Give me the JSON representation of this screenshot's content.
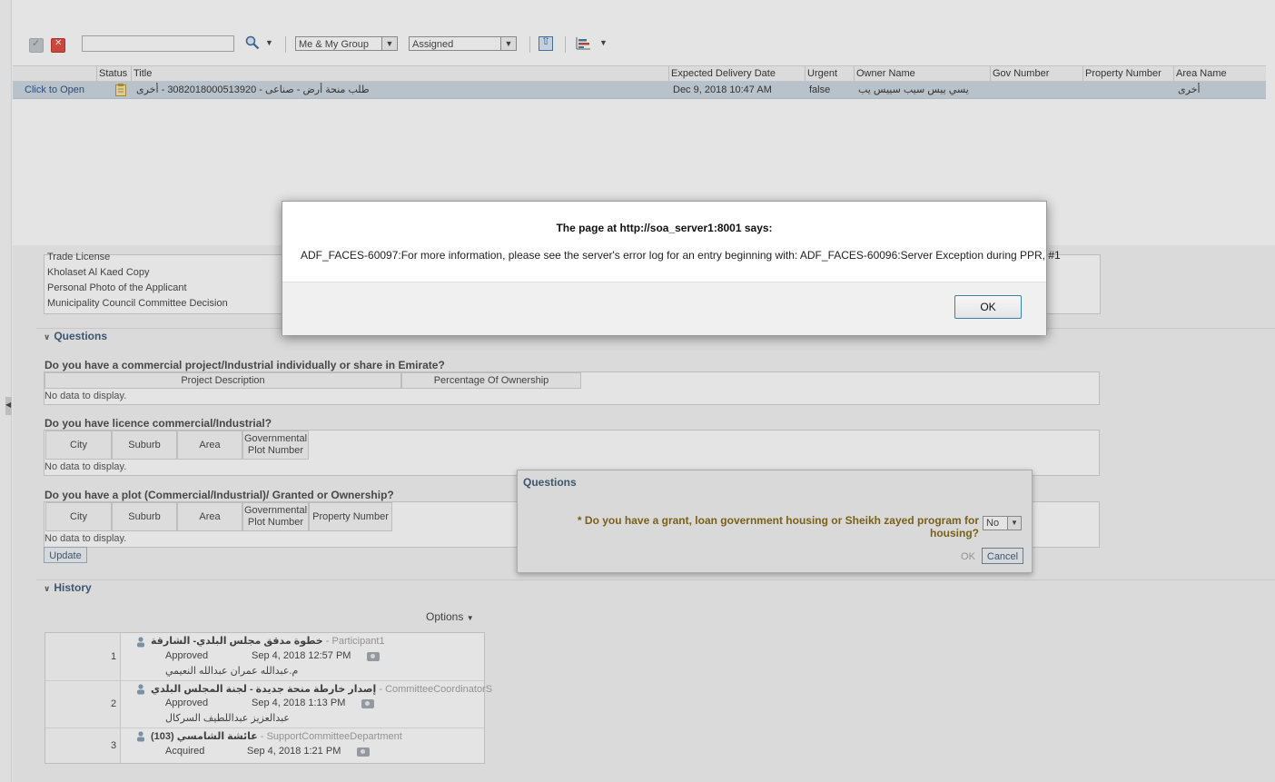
{
  "toolbar": {
    "search_value": "",
    "filter_select": "Me & My Group",
    "state_select": "Assigned"
  },
  "task_table": {
    "columns": [
      "Status",
      "Title",
      "Expected Delivery Date",
      "Urgent",
      "Owner Name",
      "Gov Number",
      "Property Number",
      "Area Name"
    ],
    "row": {
      "open_link": "Click to Open",
      "title": "طلب منحة أرض - صناعى - 3082018000513920 - أخرى",
      "expected_delivery": "Dec 9, 2018 10:47 AM",
      "urgent": "false",
      "owner": "يسي ييس سيب سييس يب",
      "gov_number": "",
      "property_number": "",
      "area": "أخرى"
    }
  },
  "documents": [
    "Trade License",
    "Kholaset Al Kaed Copy",
    "Personal Photo of the Applicant",
    "Municipality Council Committee Decision"
  ],
  "questions": {
    "header": "Questions",
    "q1": {
      "label": "Do you have a commercial project/Industrial individually or share in Emirate?",
      "columns": [
        "Project Description",
        "Percentage Of Ownership"
      ],
      "empty": "No data to display."
    },
    "q2": {
      "label": "Do you have licence commercial/Industrial?",
      "columns": [
        "City",
        "Suburb",
        "Area",
        "Governmental Plot Number"
      ],
      "empty": "No data to display."
    },
    "q3": {
      "label": "Do you have a plot (Commercial/Industrial)/ Granted or Ownership?",
      "columns": [
        "City",
        "Suburb",
        "Area",
        "Governmental Plot Number",
        "Property Number"
      ],
      "empty": "No data to display."
    },
    "update_label": "Update"
  },
  "history": {
    "header": "History",
    "options_label": "Options",
    "rows": [
      {
        "num": "1",
        "step": "خطوة مدقق مجلس البلدي- الشارقة",
        "role": "- Participant1",
        "status": "Approved",
        "date": "Sep 4, 2018 12:57 PM",
        "user": "م.عبدالله عمران عبدالله النعيمي"
      },
      {
        "num": "2",
        "step": "إصدار خارطة منحة جديدة - لجنة المجلس البلدي",
        "role": "- CommitteeCoordinatorS",
        "status": "Approved",
        "date": "Sep 4, 2018 1:13 PM",
        "user": "عبدالعزيز عبداللطيف السركال"
      },
      {
        "num": "3",
        "step": "عائشة الشامسي (103)",
        "role": "- SupportCommitteeDepartment",
        "status": "Acquired",
        "date": "Sep 4, 2018 1:21 PM",
        "user": ""
      }
    ]
  },
  "q_popup": {
    "title": "Questions",
    "required_mark": "*",
    "question": "Do you have a grant, loan government housing or Sheikh zayed program for housing?",
    "answer": "No",
    "ok_label": "OK",
    "cancel_label": "Cancel"
  },
  "alert": {
    "title": "The page at http://soa_server1:8001 says:",
    "message": "ADF_FACES-60097:For more information, please see the server's error log for an entry beginning with: ADF_FACES-60096:Server Exception during PPR, #1",
    "ok_label": "OK"
  }
}
